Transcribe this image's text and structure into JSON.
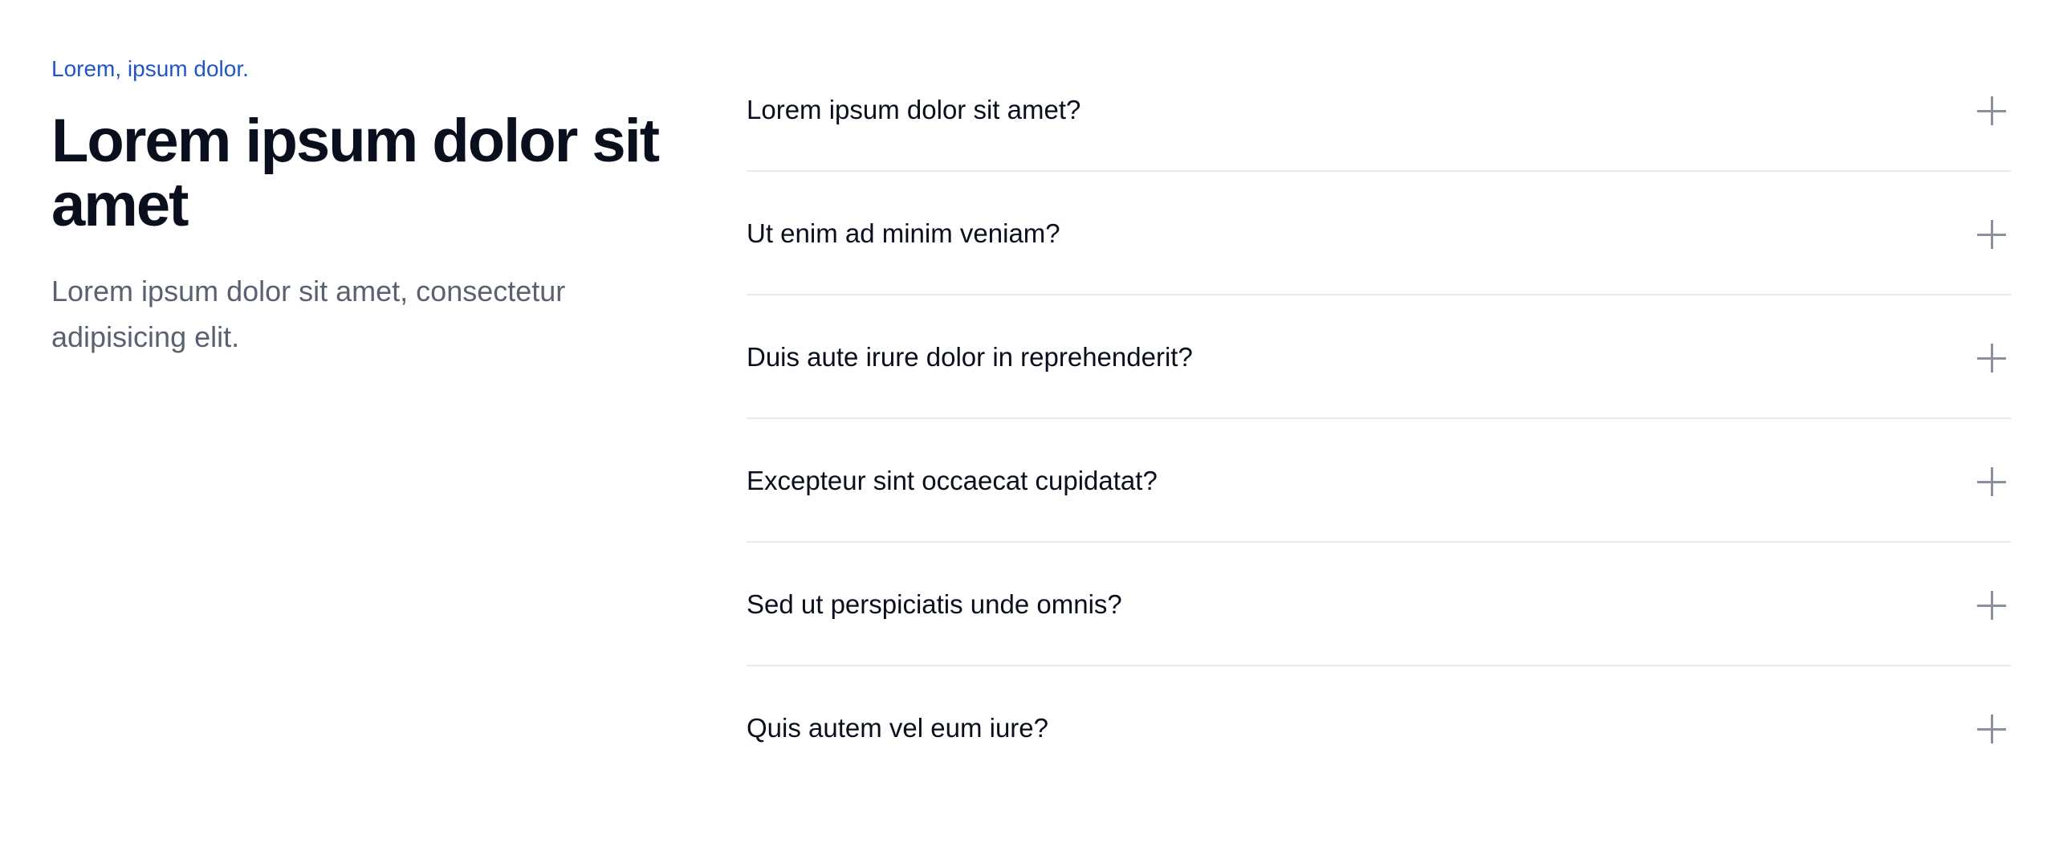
{
  "intro": {
    "eyebrow": "Lorem, ipsum dolor.",
    "headline": "Lorem ipsum dolor sit amet",
    "subtext": "Lorem ipsum dolor sit amet, consectetur adipisicing elit."
  },
  "faq": {
    "items": [
      {
        "question": "Lorem ipsum dolor sit amet?",
        "icon": "plus-icon"
      },
      {
        "question": "Ut enim ad minim veniam?",
        "icon": "plus-icon"
      },
      {
        "question": "Duis aute irure dolor in reprehenderit?",
        "icon": "plus-icon"
      },
      {
        "question": "Excepteur sint occaecat cupidatat?",
        "icon": "plus-icon"
      },
      {
        "question": "Sed ut perspiciatis unde omnis?",
        "icon": "plus-icon"
      },
      {
        "question": "Quis autem vel eum iure?",
        "icon": "plus-icon"
      }
    ]
  },
  "colors": {
    "accent": "#2256c5",
    "heading": "#0a0f1e",
    "muted_text": "#5a6272",
    "divider": "#e7e9ee",
    "icon": "#8a919c"
  }
}
